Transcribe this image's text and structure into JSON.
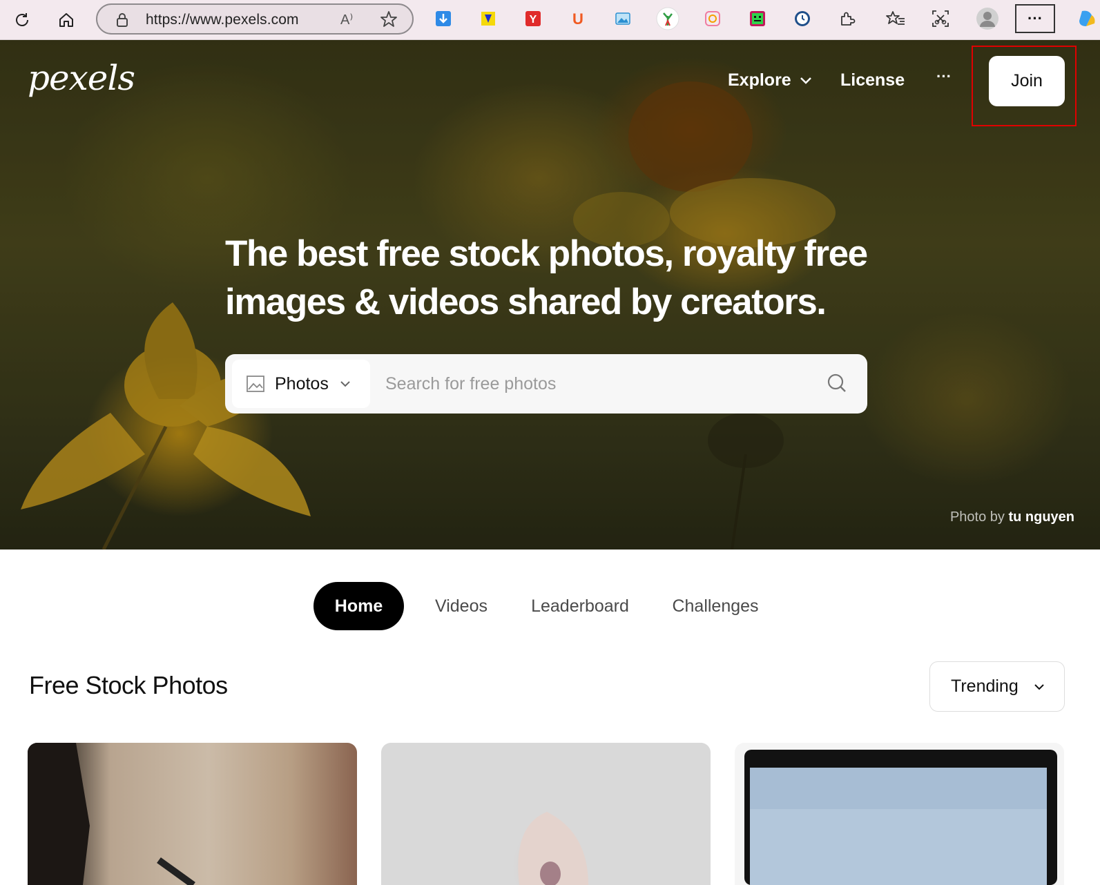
{
  "browser": {
    "url": "https://www.pexels.com",
    "read_aloud": "A⁾",
    "more": "···"
  },
  "site": {
    "logo": "pexels",
    "nav": {
      "explore": "Explore",
      "license": "License",
      "more": "···",
      "join": "Join"
    },
    "headline_line1": "The best free stock photos, royalty free",
    "headline_line2": "images & videos shared by creators.",
    "search": {
      "type_label": "Photos",
      "placeholder": "Search for free photos"
    },
    "credit_prefix": "Photo by",
    "credit_name": "tu nguyen",
    "tabs": [
      "Home",
      "Videos",
      "Leaderboard",
      "Challenges"
    ],
    "section_title": "Free Stock Photos",
    "sort_label": "Trending"
  },
  "colors": {
    "chrome_bg": "#f3e9ee",
    "accent_black": "#000000",
    "highlight_red": "#e00000"
  },
  "icons": [
    "refresh-icon",
    "home-icon",
    "lock-icon",
    "favorite-star-icon",
    "extensions-icon",
    "favorites-icon",
    "screenshot-icon",
    "profile-icon",
    "image-icon",
    "chevron-down-icon",
    "search-icon"
  ]
}
